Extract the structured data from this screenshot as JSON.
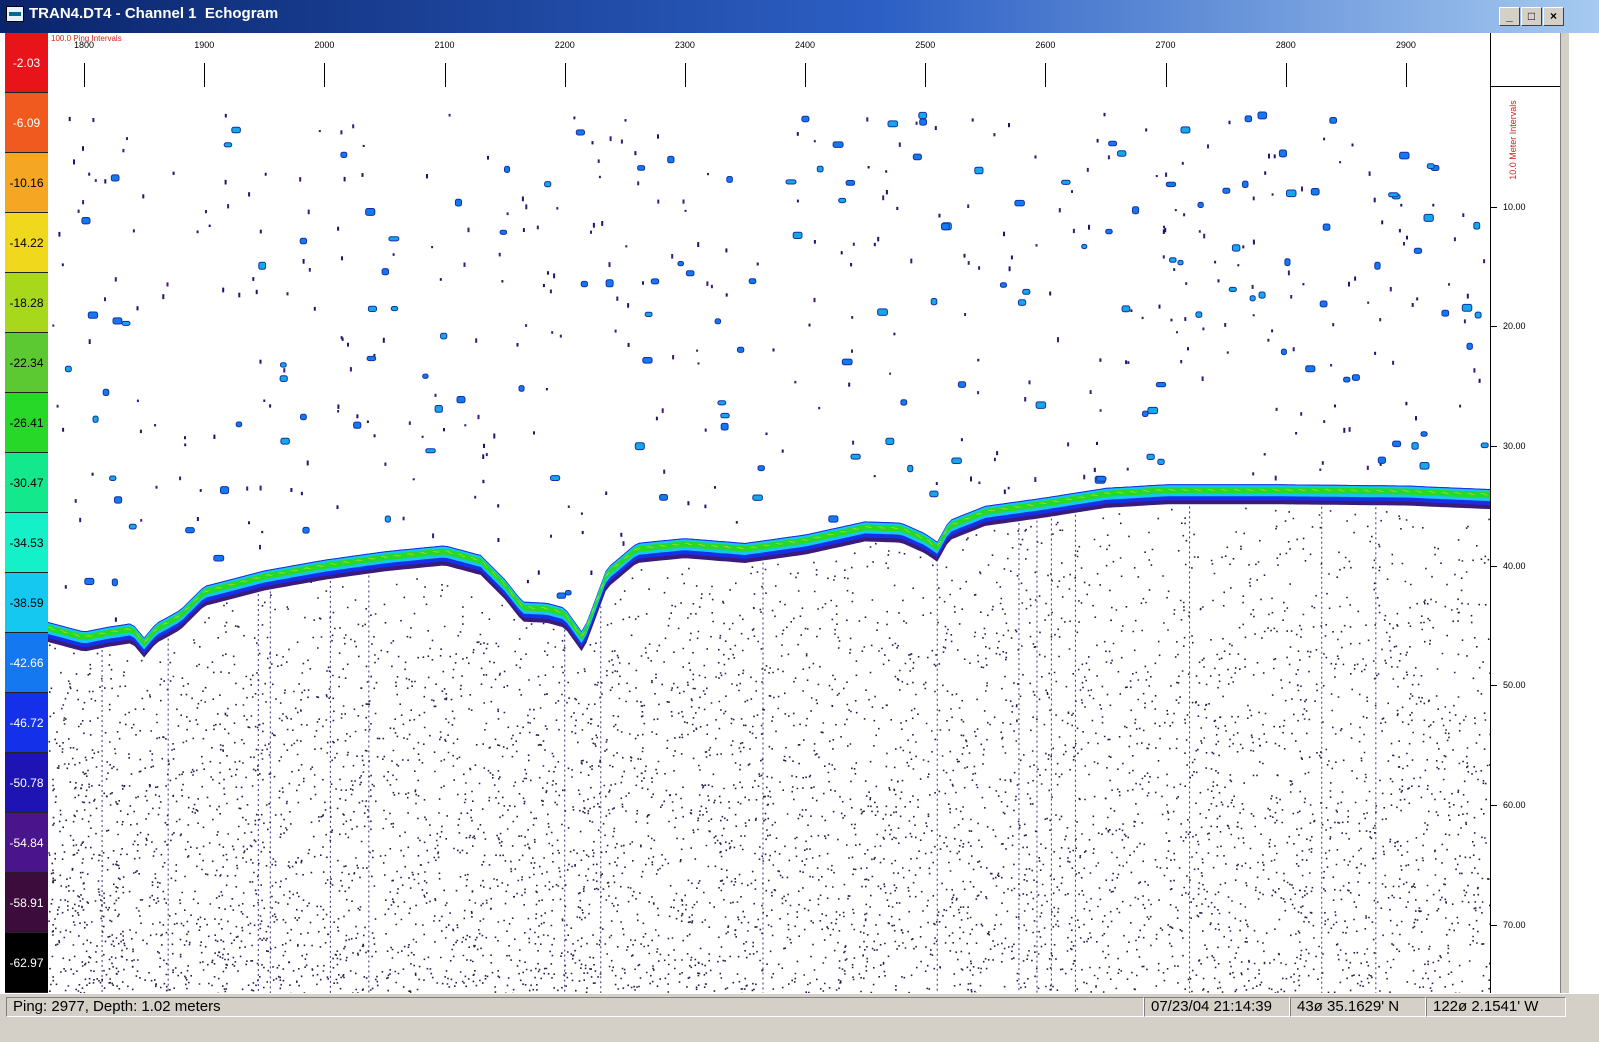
{
  "window": {
    "title": "TRAN4.DT4 - Channel 1  Echogram",
    "minimize_label": "_",
    "maximize_label": "□",
    "close_label": "×"
  },
  "color_scale": {
    "cells": [
      {
        "label": "-2.03",
        "color": "#e8141a",
        "text_color": "#ffffff"
      },
      {
        "label": "-6.09",
        "color": "#f05a1e",
        "text_color": "#ffffff"
      },
      {
        "label": "-10.16",
        "color": "#f5a623",
        "text_color": "#000000"
      },
      {
        "label": "-14.22",
        "color": "#f0d81c",
        "text_color": "#000000"
      },
      {
        "label": "-18.28",
        "color": "#a8d81c",
        "text_color": "#000000"
      },
      {
        "label": "-22.34",
        "color": "#5cc832",
        "text_color": "#000000"
      },
      {
        "label": "-26.41",
        "color": "#28d828",
        "text_color": "#000000"
      },
      {
        "label": "-30.47",
        "color": "#14e88c",
        "text_color": "#000000"
      },
      {
        "label": "-34.53",
        "color": "#14f0c8",
        "text_color": "#000000"
      },
      {
        "label": "-38.59",
        "color": "#14c8f0",
        "text_color": "#000000"
      },
      {
        "label": "-42.66",
        "color": "#1478f0",
        "text_color": "#ffffff"
      },
      {
        "label": "-46.72",
        "color": "#1430e8",
        "text_color": "#ffffff"
      },
      {
        "label": "-50.78",
        "color": "#1e14b4",
        "text_color": "#ffffff"
      },
      {
        "label": "-54.84",
        "color": "#4a148c",
        "text_color": "#ffffff"
      },
      {
        "label": "-58.91",
        "color": "#3c0c3c",
        "text_color": "#ffffff"
      },
      {
        "label": "-62.97",
        "color": "#000000",
        "text_color": "#ffffff"
      }
    ]
  },
  "ping_axis": {
    "note": "100.0 Ping Intervals",
    "range": [
      1770,
      2970
    ],
    "ticks": [
      "1800",
      "1900",
      "2000",
      "2100",
      "2200",
      "2300",
      "2400",
      "2500",
      "2600",
      "2700",
      "2800",
      "2900"
    ]
  },
  "depth_axis": {
    "note": "10.0 Meter Intervals",
    "range": [
      0,
      75.7
    ],
    "ticks": [
      "10.00",
      "20.00",
      "30.00",
      "40.00",
      "50.00",
      "60.00",
      "70.00"
    ]
  },
  "status": {
    "ping_depth": "Ping: 2977, Depth: 1.02 meters",
    "datetime": "07/23/04 21:14:39",
    "latitude": "43ø 35.1629' N",
    "longitude": "122ø 2.1541' W"
  },
  "bottom_profile": {
    "ping": [
      1770,
      1800,
      1820,
      1840,
      1850,
      1860,
      1880,
      1900,
      1950,
      2000,
      2050,
      2100,
      2130,
      2150,
      2165,
      2185,
      2200,
      2215,
      2235,
      2260,
      2300,
      2350,
      2400,
      2450,
      2480,
      2500,
      2510,
      2520,
      2550,
      2600,
      2650,
      2700,
      2800,
      2900,
      2970
    ],
    "depth_m": [
      45.2,
      46.0,
      45.6,
      45.3,
      46.5,
      45.3,
      44.2,
      42.2,
      40.9,
      40.0,
      39.3,
      38.8,
      39.6,
      41.6,
      43.5,
      43.6,
      44.0,
      46.1,
      40.7,
      38.6,
      38.2,
      38.6,
      37.9,
      36.8,
      36.9,
      37.8,
      38.5,
      36.7,
      35.5,
      34.8,
      34.0,
      33.7,
      33.7,
      33.8,
      34.1
    ]
  }
}
